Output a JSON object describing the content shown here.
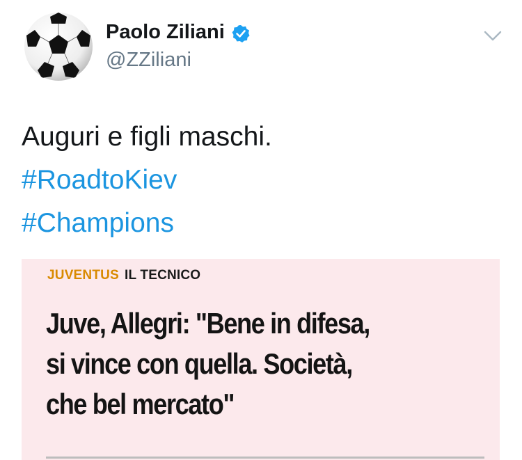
{
  "author": {
    "display_name": "Paolo Ziliani",
    "handle": "@ZZiliani",
    "avatar_icon": "soccer-ball-icon",
    "verified_icon": "verified-badge-icon"
  },
  "menu": {
    "caret_icon": "chevron-down-icon"
  },
  "tweet": {
    "text_line": "Auguri e figli maschi.",
    "hashtags": [
      "#RoadtoKiev",
      "#Champions"
    ]
  },
  "media": {
    "kicker_team": "JUVENTUS",
    "kicker_section": "IL TECNICO",
    "headline_lines": [
      "Juve, Allegri: \"Bene in difesa,",
      "si vince con quella. Società,",
      "che bel mercato\""
    ]
  },
  "colors": {
    "link": "#1b95e0",
    "verified": "#1da1f2",
    "card_background": "#fce9ec",
    "kicker_team": "#d98a00"
  }
}
